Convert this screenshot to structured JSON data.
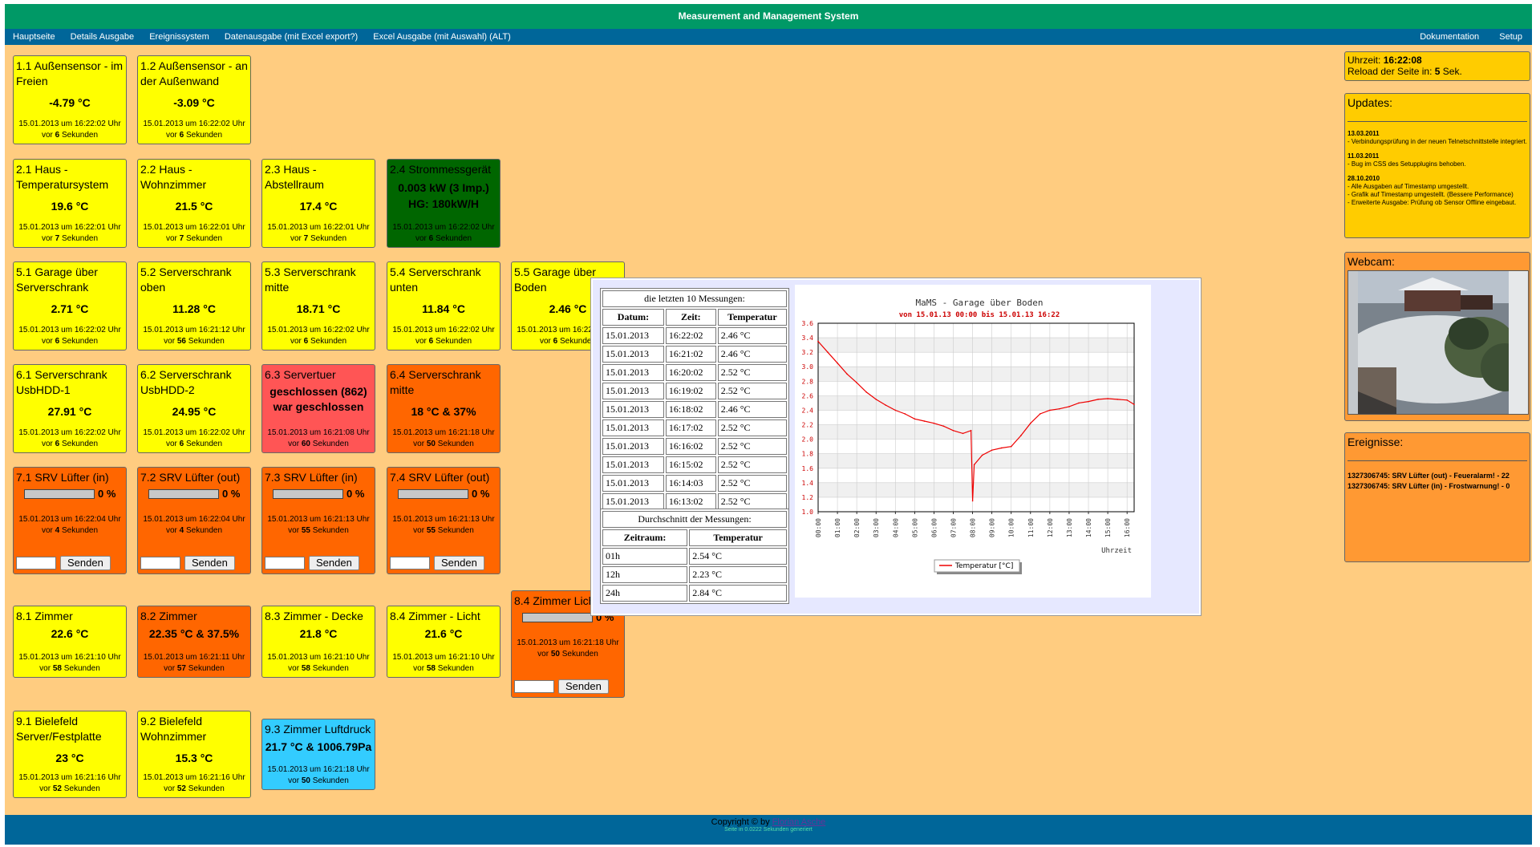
{
  "app": {
    "title": "Measurement and Management System"
  },
  "menu": {
    "left": [
      "Hauptseite",
      "Details Ausgabe",
      "Ereignissystem",
      "Datenausgabe (mit Excel export?)",
      "Excel Ausgabe (mit Auswahl) (ALT)"
    ],
    "right": [
      "Dokumentation",
      "Setup"
    ]
  },
  "tiles": {
    "t11": {
      "name": "1.1 Außensensor - im Freien",
      "value": "-4.79 °C",
      "date": "15.01.2013 um 16:22:02 Uhr",
      "ago_pre": "vor",
      "ago_n": "6",
      "ago_post": "Sekunden"
    },
    "t12": {
      "name": "1.2 Außensensor - an der Außenwand",
      "value": "-3.09 °C",
      "date": "15.01.2013 um 16:22:02 Uhr",
      "ago_pre": "vor",
      "ago_n": "6",
      "ago_post": "Sekunden"
    },
    "t21": {
      "name": "2.1 Haus - Temperatursystem",
      "value": "19.6 °C",
      "date": "15.01.2013 um 16:22:01 Uhr",
      "ago_pre": "vor",
      "ago_n": "7",
      "ago_post": "Sekunden"
    },
    "t22": {
      "name": "2.2 Haus - Wohnzimmer",
      "value": "21.5 °C",
      "date": "15.01.2013 um 16:22:01 Uhr",
      "ago_pre": "vor",
      "ago_n": "7",
      "ago_post": "Sekunden"
    },
    "t23": {
      "name": "2.3 Haus - Abstellraum",
      "value": "17.4 °C",
      "date": "15.01.2013 um 16:22:01 Uhr",
      "ago_pre": "vor",
      "ago_n": "7",
      "ago_post": "Sekunden"
    },
    "t24": {
      "name": "2.4 Strommessgerät",
      "value": "0.003 kW (3 Imp.)",
      "value2": "HG: 180kW/H",
      "date": "15.01.2013 um 16:22:02 Uhr",
      "ago_pre": "vor",
      "ago_n": "6",
      "ago_post": "Sekunden"
    },
    "t51": {
      "name": "5.1 Garage über Serverschrank",
      "value": "2.71 °C",
      "date": "15.01.2013 um 16:22:02 Uhr",
      "ago_pre": "vor",
      "ago_n": "6",
      "ago_post": "Sekunden"
    },
    "t52": {
      "name": "5.2 Serverschrank oben",
      "value": "11.28 °C",
      "date": "15.01.2013 um 16:21:12 Uhr",
      "ago_pre": "vor",
      "ago_n": "56",
      "ago_post": "Sekunden"
    },
    "t53": {
      "name": "5.3 Serverschrank mitte",
      "value": "18.71 °C",
      "date": "15.01.2013 um 16:22:02 Uhr",
      "ago_pre": "vor",
      "ago_n": "6",
      "ago_post": "Sekunden"
    },
    "t54": {
      "name": "5.4 Serverschrank unten",
      "value": "11.84 °C",
      "date": "15.01.2013 um 16:22:02 Uhr",
      "ago_pre": "vor",
      "ago_n": "6",
      "ago_post": "Sekunden"
    },
    "t55": {
      "name": "5.5 Garage über Boden",
      "value": "2.46 °C",
      "date": "15.01.2013 um 16:22:02 Uhr",
      "ago_pre": "vor",
      "ago_n": "6",
      "ago_post": "Sekunden"
    },
    "t61": {
      "name": "6.1 Serverschrank UsbHDD-1",
      "value": "27.91 °C",
      "date": "15.01.2013 um 16:22:02 Uhr",
      "ago_pre": "vor",
      "ago_n": "6",
      "ago_post": "Sekunden"
    },
    "t62": {
      "name": "6.2 Serverschrank UsbHDD-2",
      "value": "24.95 °C",
      "date": "15.01.2013 um 16:22:02 Uhr",
      "ago_pre": "vor",
      "ago_n": "6",
      "ago_post": "Sekunden"
    },
    "t63": {
      "name": "6.3 Servertuer",
      "value": "geschlossen (862)",
      "value2": "war geschlossen",
      "date": "15.01.2013 um 16:21:08 Uhr",
      "ago_pre": "vor",
      "ago_n": "60",
      "ago_post": "Sekunden"
    },
    "t64": {
      "name": "6.4 Serverschrank mitte",
      "value": "18 °C & 37%",
      "date": "15.01.2013 um 16:21:18 Uhr",
      "ago_pre": "vor",
      "ago_n": "50",
      "ago_post": "Sekunden"
    },
    "t71": {
      "name": "7.1 SRV Lüfter (in)",
      "pct": "0 %",
      "date": "15.01.2013 um 16:22:04 Uhr",
      "ago_pre": "vor",
      "ago_n": "4",
      "ago_post": "Sekunden",
      "button": "Senden"
    },
    "t72": {
      "name": "7.2 SRV Lüfter (out)",
      "pct": "0 %",
      "date": "15.01.2013 um 16:22:04 Uhr",
      "ago_pre": "vor",
      "ago_n": "4",
      "ago_post": "Sekunden",
      "button": "Senden"
    },
    "t73": {
      "name": "7.3 SRV Lüfter (in)",
      "pct": "0 %",
      "date": "15.01.2013 um 16:21:13 Uhr",
      "ago_pre": "vor",
      "ago_n": "55",
      "ago_post": "Sekunden",
      "button": "Senden"
    },
    "t74": {
      "name": "7.4 SRV Lüfter (out)",
      "pct": "0 %",
      "date": "15.01.2013 um 16:21:13 Uhr",
      "ago_pre": "vor",
      "ago_n": "55",
      "ago_post": "Sekunden",
      "button": "Senden"
    },
    "t81": {
      "name": "8.1 Zimmer",
      "value": "22.6 °C",
      "date": "15.01.2013 um 16:21:10 Uhr",
      "ago_pre": "vor",
      "ago_n": "58",
      "ago_post": "Sekunden"
    },
    "t82": {
      "name": "8.2 Zimmer",
      "value": "22.35 °C & 37.5%",
      "date": "15.01.2013 um 16:21:11 Uhr",
      "ago_pre": "vor",
      "ago_n": "57",
      "ago_post": "Sekunden"
    },
    "t83": {
      "name": "8.3 Zimmer - Decke",
      "value": "21.8 °C",
      "date": "15.01.2013 um 16:21:10 Uhr",
      "ago_pre": "vor",
      "ago_n": "58",
      "ago_post": "Sekunden"
    },
    "t84": {
      "name": "8.4 Zimmer - Licht",
      "value": "21.6 °C",
      "date": "15.01.2013 um 16:21:10 Uhr",
      "ago_pre": "vor",
      "ago_n": "58",
      "ago_post": "Sekunden"
    },
    "t84b": {
      "name": "8.4 Zimmer Licht",
      "pct": "0 %",
      "date": "15.01.2013 um 16:21:18 Uhr",
      "ago_pre": "vor",
      "ago_n": "50",
      "ago_post": "Sekunden",
      "button": "Senden"
    },
    "t91": {
      "name": "9.1 Bielefeld Server/Festplatte",
      "value": "23 °C",
      "date": "15.01.2013 um 16:21:16 Uhr",
      "ago_pre": "vor",
      "ago_n": "52",
      "ago_post": "Sekunden"
    },
    "t92": {
      "name": "9.2 Bielefeld Wohnzimmer",
      "value": "15.3 °C",
      "date": "15.01.2013 um 16:21:16 Uhr",
      "ago_pre": "vor",
      "ago_n": "52",
      "ago_post": "Sekunden"
    },
    "t93": {
      "name": "9.3 Zimmer Luftdruck",
      "value": "21.7 °C & 1006.79Pa",
      "date": "15.01.2013 um 16:21:18 Uhr",
      "ago_pre": "vor",
      "ago_n": "50",
      "ago_post": "Sekunden"
    }
  },
  "sidebar": {
    "clock_label": "Uhrzeit:",
    "clock_time": "16:22:08",
    "reload_pre": "Reload der Seite in:",
    "reload_n": "5",
    "reload_post": "Sek.",
    "updates_title": "Updates:",
    "updates": [
      {
        "date": "13.03.2011",
        "lines": [
          "- Verbindungsprüfung in der neuen Telnetschnittstelle integriert."
        ]
      },
      {
        "date": "11.03.2011",
        "lines": [
          "- Bug im CSS des Setupplugins behoben."
        ]
      },
      {
        "date": "28.10.2010",
        "lines": [
          "- Alle Ausgaben auf Timestamp umgestellt.",
          "- Grafik auf Timestamp umgestellt. (Bessere Performance)",
          "- Erweiterte Ausgabe: Prüfung ob Sensor Offline eingebaut."
        ]
      }
    ],
    "webcam_title": "Webcam:",
    "events_title": "Ereignisse:",
    "events": [
      "1327306745: SRV Lüfter (out) - Feueralarm! - 22",
      "1327306745: SRV Lüfter (in) - Frostwarnung! - 0"
    ]
  },
  "popup": {
    "last10_header": "die letzten 10 Messungen:",
    "cols": [
      "Datum:",
      "Zeit:",
      "Temperatur"
    ],
    "rows": [
      [
        "15.01.2013",
        "16:22:02",
        "2.46 °C"
      ],
      [
        "15.01.2013",
        "16:21:02",
        "2.46 °C"
      ],
      [
        "15.01.2013",
        "16:20:02",
        "2.52 °C"
      ],
      [
        "15.01.2013",
        "16:19:02",
        "2.52 °C"
      ],
      [
        "15.01.2013",
        "16:18:02",
        "2.46 °C"
      ],
      [
        "15.01.2013",
        "16:17:02",
        "2.52 °C"
      ],
      [
        "15.01.2013",
        "16:16:02",
        "2.52 °C"
      ],
      [
        "15.01.2013",
        "16:15:02",
        "2.52 °C"
      ],
      [
        "15.01.2013",
        "16:14:03",
        "2.52 °C"
      ],
      [
        "15.01.2013",
        "16:13:02",
        "2.52 °C"
      ]
    ],
    "avg_header": "Durchschnitt der Messungen:",
    "avg_cols": [
      "Zeitraum:",
      "Temperatur"
    ],
    "avg_rows": [
      [
        "01h",
        "2.54 °C"
      ],
      [
        "12h",
        "2.23 °C"
      ],
      [
        "24h",
        "2.84 °C"
      ]
    ]
  },
  "chart_data": {
    "type": "line",
    "title": "MaMS - Garage über Boden",
    "subtitle": "von 15.01.13 00:00 bis 15.01.13 16:22",
    "xlabel": "Uhrzeit",
    "ylabel": "",
    "x_ticks": [
      "00:00",
      "01:00",
      "02:00",
      "03:00",
      "04:00",
      "05:00",
      "06:00",
      "07:00",
      "08:00",
      "09:00",
      "10:00",
      "11:00",
      "12:00",
      "13:00",
      "14:00",
      "15:00",
      "16:00"
    ],
    "y_ticks": [
      "1.0",
      "1.2",
      "1.4",
      "1.6",
      "1.8",
      "2.0",
      "2.2",
      "2.4",
      "2.6",
      "2.8",
      "3.0",
      "3.2",
      "3.4",
      "3.6"
    ],
    "ylim": [
      1.0,
      3.6
    ],
    "xlim": [
      "00:00",
      "16:22"
    ],
    "grid": true,
    "legend_position": "bottom",
    "series": [
      {
        "name": "Temperatur [°C]",
        "color": "#ee0000",
        "x": [
          "00:00",
          "00:30",
          "01:00",
          "01:30",
          "02:00",
          "02:30",
          "03:00",
          "03:30",
          "04:00",
          "04:30",
          "05:00",
          "05:30",
          "06:00",
          "06:30",
          "07:00",
          "07:30",
          "07:55",
          "08:00",
          "08:05",
          "08:30",
          "09:00",
          "09:30",
          "10:00",
          "10:30",
          "11:00",
          "11:30",
          "12:00",
          "12:30",
          "13:00",
          "13:30",
          "14:00",
          "14:30",
          "15:00",
          "15:30",
          "16:00",
          "16:22"
        ],
        "y": [
          3.35,
          3.2,
          3.05,
          2.9,
          2.78,
          2.65,
          2.55,
          2.47,
          2.4,
          2.35,
          2.28,
          2.25,
          2.22,
          2.18,
          2.12,
          2.08,
          2.12,
          1.15,
          1.65,
          1.78,
          1.85,
          1.88,
          1.9,
          2.05,
          2.22,
          2.35,
          2.4,
          2.42,
          2.45,
          2.5,
          2.52,
          2.55,
          2.56,
          2.55,
          2.54,
          2.48
        ]
      }
    ]
  }
}
